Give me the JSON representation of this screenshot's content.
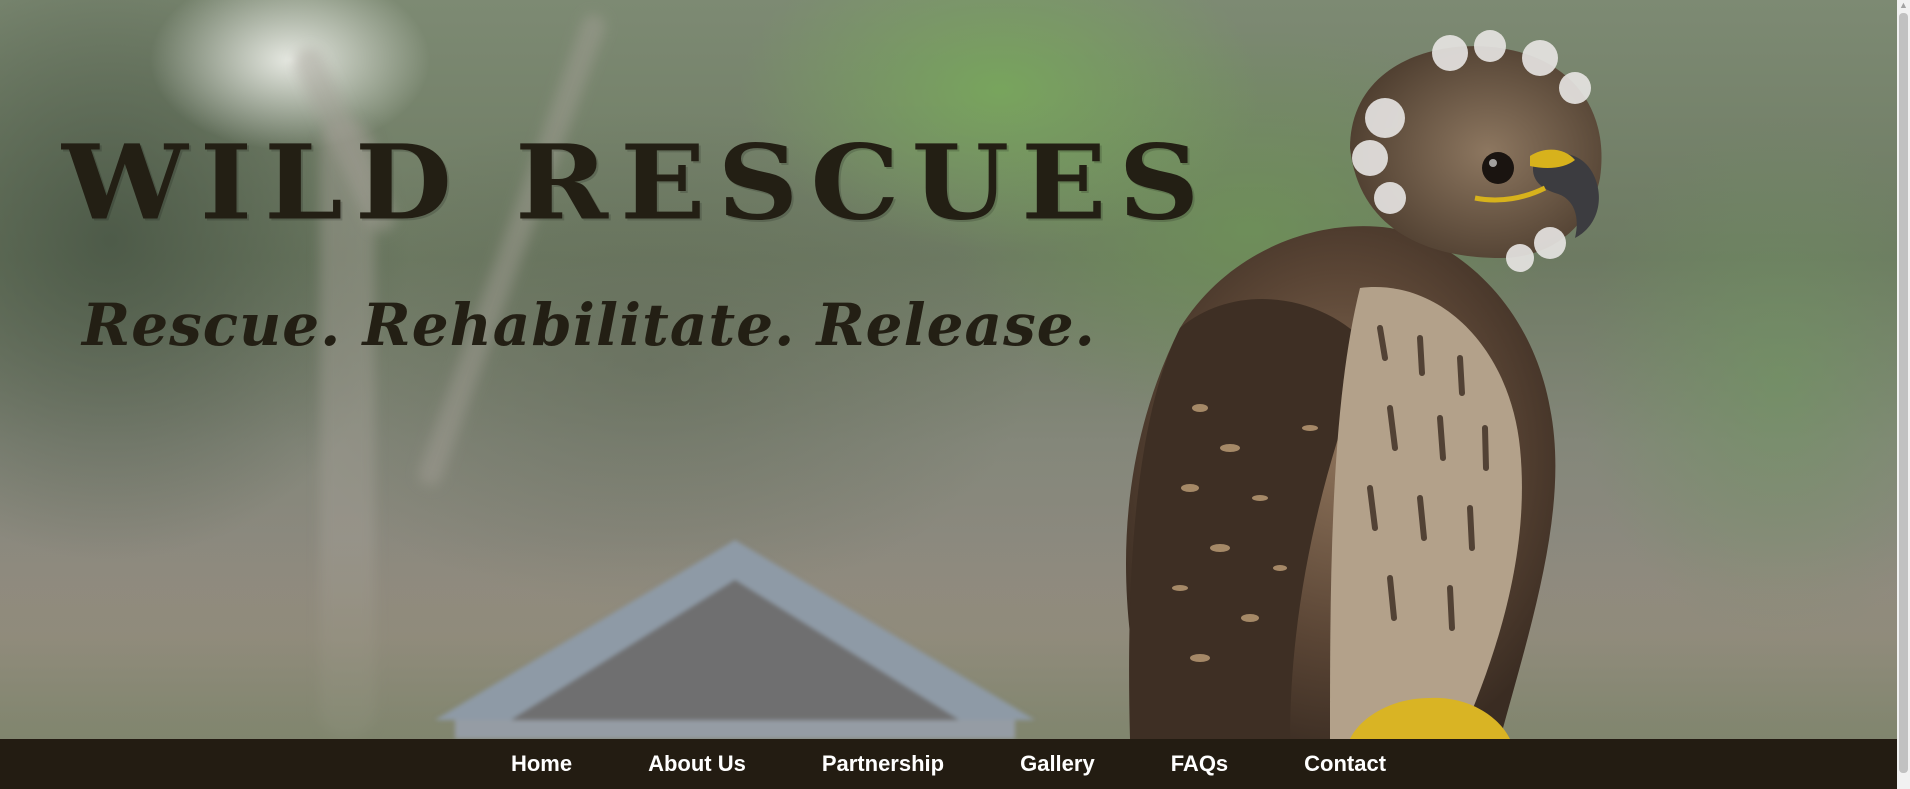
{
  "hero": {
    "title": "WILD RESCUES",
    "tagline": "Rescue. Rehabilitate. Release.",
    "image_alt": "juvenile-hawk-on-gloved-hand"
  },
  "nav": {
    "items": [
      {
        "label": "Home"
      },
      {
        "label": "About Us"
      },
      {
        "label": "Partnership"
      },
      {
        "label": "Gallery"
      },
      {
        "label": "FAQs"
      },
      {
        "label": "Contact"
      }
    ]
  },
  "colors": {
    "title_text": "#231f14",
    "nav_background": "#231c12",
    "nav_text": "#ffffff"
  }
}
